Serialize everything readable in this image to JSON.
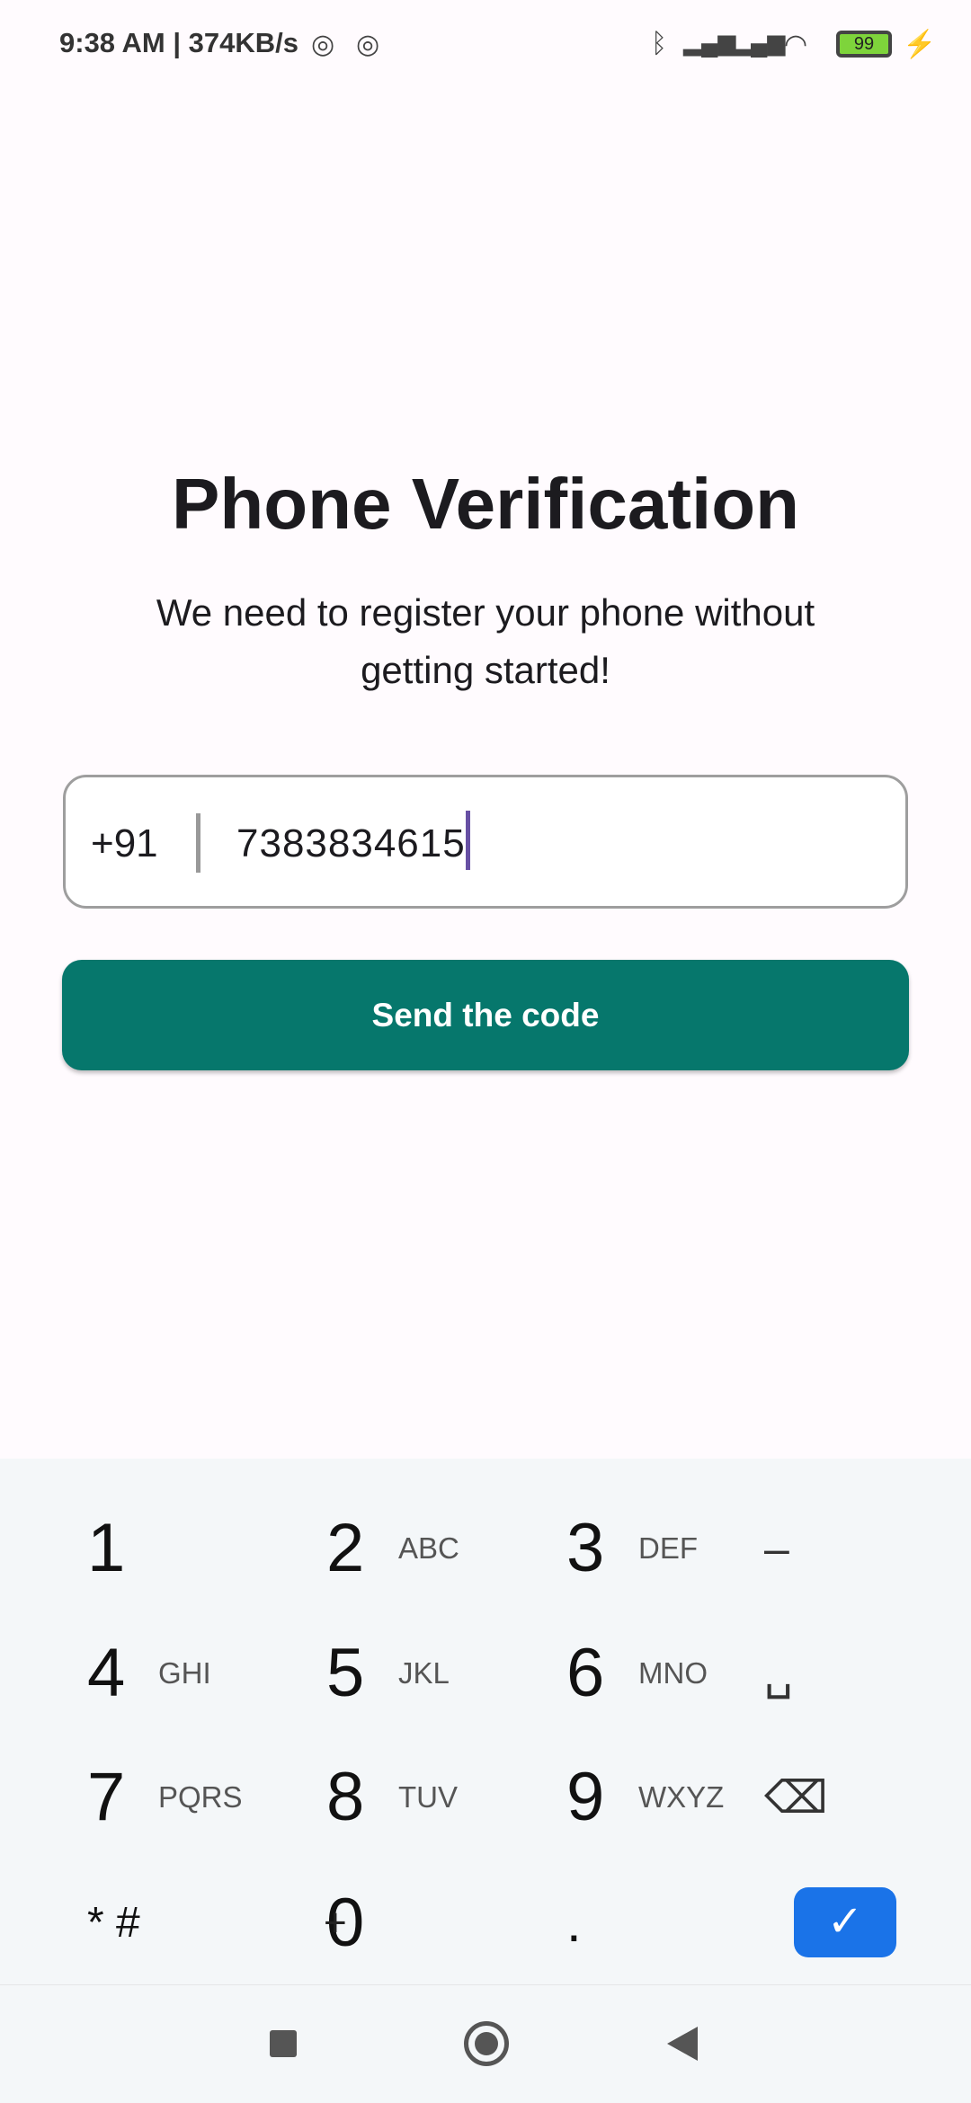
{
  "status_bar": {
    "time": "9:38 AM",
    "speed": "374KB/s",
    "battery": "99"
  },
  "page": {
    "title": "Phone Verification",
    "subtitle": "We need to register your phone without getting started!"
  },
  "phone_field": {
    "country_code": "+91",
    "value": "7383834615"
  },
  "send_button": "Send the code",
  "colors": {
    "accent": "#06776c",
    "caret": "#6750a4",
    "done": "#1a73e8"
  },
  "keypad": {
    "keys": [
      {
        "digit": "1",
        "letters": ""
      },
      {
        "digit": "2",
        "letters": "ABC"
      },
      {
        "digit": "3",
        "letters": "DEF"
      },
      {
        "digit": "–",
        "letters": ""
      },
      {
        "digit": "4",
        "letters": "GHI"
      },
      {
        "digit": "5",
        "letters": "JKL"
      },
      {
        "digit": "6",
        "letters": "MNO"
      },
      {
        "digit": "␣",
        "letters": ""
      },
      {
        "digit": "7",
        "letters": "PQRS"
      },
      {
        "digit": "8",
        "letters": "TUV"
      },
      {
        "digit": "9",
        "letters": "WXYZ"
      },
      {
        "digit": "⌫",
        "letters": ""
      },
      {
        "digit": "* #",
        "letters": ""
      },
      {
        "digit": "0",
        "letters": "+"
      },
      {
        "digit": ".",
        "letters": ""
      },
      {
        "digit": "✓",
        "letters": ""
      }
    ]
  }
}
